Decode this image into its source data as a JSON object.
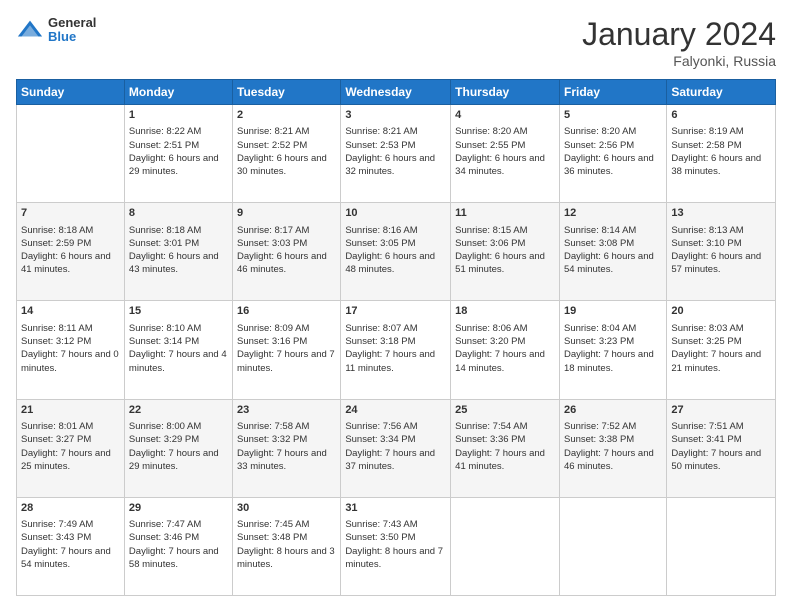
{
  "header": {
    "logo_general": "General",
    "logo_blue": "Blue",
    "month_year": "January 2024",
    "location": "Falyonki, Russia"
  },
  "weekdays": [
    "Sunday",
    "Monday",
    "Tuesday",
    "Wednesday",
    "Thursday",
    "Friday",
    "Saturday"
  ],
  "weeks": [
    [
      {
        "day": "",
        "sunrise": "",
        "sunset": "",
        "daylight": ""
      },
      {
        "day": "1",
        "sunrise": "Sunrise: 8:22 AM",
        "sunset": "Sunset: 2:51 PM",
        "daylight": "Daylight: 6 hours and 29 minutes."
      },
      {
        "day": "2",
        "sunrise": "Sunrise: 8:21 AM",
        "sunset": "Sunset: 2:52 PM",
        "daylight": "Daylight: 6 hours and 30 minutes."
      },
      {
        "day": "3",
        "sunrise": "Sunrise: 8:21 AM",
        "sunset": "Sunset: 2:53 PM",
        "daylight": "Daylight: 6 hours and 32 minutes."
      },
      {
        "day": "4",
        "sunrise": "Sunrise: 8:20 AM",
        "sunset": "Sunset: 2:55 PM",
        "daylight": "Daylight: 6 hours and 34 minutes."
      },
      {
        "day": "5",
        "sunrise": "Sunrise: 8:20 AM",
        "sunset": "Sunset: 2:56 PM",
        "daylight": "Daylight: 6 hours and 36 minutes."
      },
      {
        "day": "6",
        "sunrise": "Sunrise: 8:19 AM",
        "sunset": "Sunset: 2:58 PM",
        "daylight": "Daylight: 6 hours and 38 minutes."
      }
    ],
    [
      {
        "day": "7",
        "sunrise": "Sunrise: 8:18 AM",
        "sunset": "Sunset: 2:59 PM",
        "daylight": "Daylight: 6 hours and 41 minutes."
      },
      {
        "day": "8",
        "sunrise": "Sunrise: 8:18 AM",
        "sunset": "Sunset: 3:01 PM",
        "daylight": "Daylight: 6 hours and 43 minutes."
      },
      {
        "day": "9",
        "sunrise": "Sunrise: 8:17 AM",
        "sunset": "Sunset: 3:03 PM",
        "daylight": "Daylight: 6 hours and 46 minutes."
      },
      {
        "day": "10",
        "sunrise": "Sunrise: 8:16 AM",
        "sunset": "Sunset: 3:05 PM",
        "daylight": "Daylight: 6 hours and 48 minutes."
      },
      {
        "day": "11",
        "sunrise": "Sunrise: 8:15 AM",
        "sunset": "Sunset: 3:06 PM",
        "daylight": "Daylight: 6 hours and 51 minutes."
      },
      {
        "day": "12",
        "sunrise": "Sunrise: 8:14 AM",
        "sunset": "Sunset: 3:08 PM",
        "daylight": "Daylight: 6 hours and 54 minutes."
      },
      {
        "day": "13",
        "sunrise": "Sunrise: 8:13 AM",
        "sunset": "Sunset: 3:10 PM",
        "daylight": "Daylight: 6 hours and 57 minutes."
      }
    ],
    [
      {
        "day": "14",
        "sunrise": "Sunrise: 8:11 AM",
        "sunset": "Sunset: 3:12 PM",
        "daylight": "Daylight: 7 hours and 0 minutes."
      },
      {
        "day": "15",
        "sunrise": "Sunrise: 8:10 AM",
        "sunset": "Sunset: 3:14 PM",
        "daylight": "Daylight: 7 hours and 4 minutes."
      },
      {
        "day": "16",
        "sunrise": "Sunrise: 8:09 AM",
        "sunset": "Sunset: 3:16 PM",
        "daylight": "Daylight: 7 hours and 7 minutes."
      },
      {
        "day": "17",
        "sunrise": "Sunrise: 8:07 AM",
        "sunset": "Sunset: 3:18 PM",
        "daylight": "Daylight: 7 hours and 11 minutes."
      },
      {
        "day": "18",
        "sunrise": "Sunrise: 8:06 AM",
        "sunset": "Sunset: 3:20 PM",
        "daylight": "Daylight: 7 hours and 14 minutes."
      },
      {
        "day": "19",
        "sunrise": "Sunrise: 8:04 AM",
        "sunset": "Sunset: 3:23 PM",
        "daylight": "Daylight: 7 hours and 18 minutes."
      },
      {
        "day": "20",
        "sunrise": "Sunrise: 8:03 AM",
        "sunset": "Sunset: 3:25 PM",
        "daylight": "Daylight: 7 hours and 21 minutes."
      }
    ],
    [
      {
        "day": "21",
        "sunrise": "Sunrise: 8:01 AM",
        "sunset": "Sunset: 3:27 PM",
        "daylight": "Daylight: 7 hours and 25 minutes."
      },
      {
        "day": "22",
        "sunrise": "Sunrise: 8:00 AM",
        "sunset": "Sunset: 3:29 PM",
        "daylight": "Daylight: 7 hours and 29 minutes."
      },
      {
        "day": "23",
        "sunrise": "Sunrise: 7:58 AM",
        "sunset": "Sunset: 3:32 PM",
        "daylight": "Daylight: 7 hours and 33 minutes."
      },
      {
        "day": "24",
        "sunrise": "Sunrise: 7:56 AM",
        "sunset": "Sunset: 3:34 PM",
        "daylight": "Daylight: 7 hours and 37 minutes."
      },
      {
        "day": "25",
        "sunrise": "Sunrise: 7:54 AM",
        "sunset": "Sunset: 3:36 PM",
        "daylight": "Daylight: 7 hours and 41 minutes."
      },
      {
        "day": "26",
        "sunrise": "Sunrise: 7:52 AM",
        "sunset": "Sunset: 3:38 PM",
        "daylight": "Daylight: 7 hours and 46 minutes."
      },
      {
        "day": "27",
        "sunrise": "Sunrise: 7:51 AM",
        "sunset": "Sunset: 3:41 PM",
        "daylight": "Daylight: 7 hours and 50 minutes."
      }
    ],
    [
      {
        "day": "28",
        "sunrise": "Sunrise: 7:49 AM",
        "sunset": "Sunset: 3:43 PM",
        "daylight": "Daylight: 7 hours and 54 minutes."
      },
      {
        "day": "29",
        "sunrise": "Sunrise: 7:47 AM",
        "sunset": "Sunset: 3:46 PM",
        "daylight": "Daylight: 7 hours and 58 minutes."
      },
      {
        "day": "30",
        "sunrise": "Sunrise: 7:45 AM",
        "sunset": "Sunset: 3:48 PM",
        "daylight": "Daylight: 8 hours and 3 minutes."
      },
      {
        "day": "31",
        "sunrise": "Sunrise: 7:43 AM",
        "sunset": "Sunset: 3:50 PM",
        "daylight": "Daylight: 8 hours and 7 minutes."
      },
      {
        "day": "",
        "sunrise": "",
        "sunset": "",
        "daylight": ""
      },
      {
        "day": "",
        "sunrise": "",
        "sunset": "",
        "daylight": ""
      },
      {
        "day": "",
        "sunrise": "",
        "sunset": "",
        "daylight": ""
      }
    ]
  ]
}
